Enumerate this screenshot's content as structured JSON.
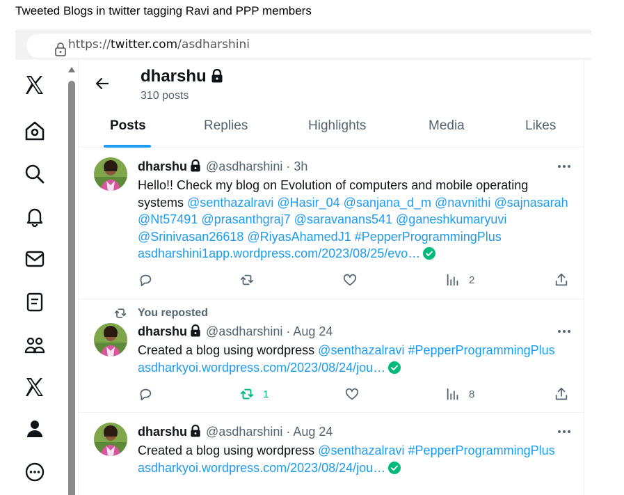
{
  "caption": "Tweeted Blogs in twitter tagging Ravi and PPP members",
  "browser": {
    "url_prefix": "https://",
    "url_domain": "twitter.com",
    "url_path": "/asdharshini"
  },
  "profile": {
    "name": "dharshu",
    "post_count": "310 posts"
  },
  "tabs": [
    {
      "label": "Posts",
      "active": true
    },
    {
      "label": "Replies"
    },
    {
      "label": "Highlights"
    },
    {
      "label": "Media"
    },
    {
      "label": "Likes"
    }
  ],
  "tweets": [
    {
      "name": "dharshu",
      "handle": "@asdharshini",
      "time": "· 3h",
      "text_plain": "Hello!! Check my blog on Evolution of computers and mobile operating systems",
      "mentions": "@senthazalravi @Hasir_04 @sanjana_d_m @navnithi @sajnasarah @Nt57491 @prasanthgraj7 @saravanans541 @ganeshkumaryuvi @Srinivasan26618 @RiyasAhamedJ1 #PepperProgrammingPlus",
      "link": "asdharshini1app.wordpress.com/2023/08/25/evo…",
      "views": "2"
    },
    {
      "repost_note": "You reposted",
      "name": "dharshu",
      "handle": "@asdharshini",
      "time": "· Aug 24",
      "text_plain": "Created a blog using wordpress",
      "mentions": "@senthazalravi #PepperProgrammingPlus",
      "link": "asdharkyoi.wordpress.com/2023/08/24/jou…",
      "reposts": "1",
      "views": "8"
    },
    {
      "name": "dharshu",
      "handle": "@asdharshini",
      "time": "· Aug 24",
      "text_plain": "Created a blog using wordpress",
      "mentions": "@senthazalravi #PepperProgrammingPlus",
      "link": "asdharkyoi.wordpress.com/2023/08/24/jou…"
    }
  ],
  "nav_icons": [
    "x-logo-icon",
    "home-icon",
    "search-icon",
    "notifications-icon",
    "messages-icon",
    "lists-icon",
    "communities-icon",
    "premium-x-icon",
    "profile-icon",
    "more-icon"
  ],
  "colors": {
    "accent": "#1d9bf0",
    "repost_green": "#00ba7c",
    "secondary_text": "#536471"
  }
}
